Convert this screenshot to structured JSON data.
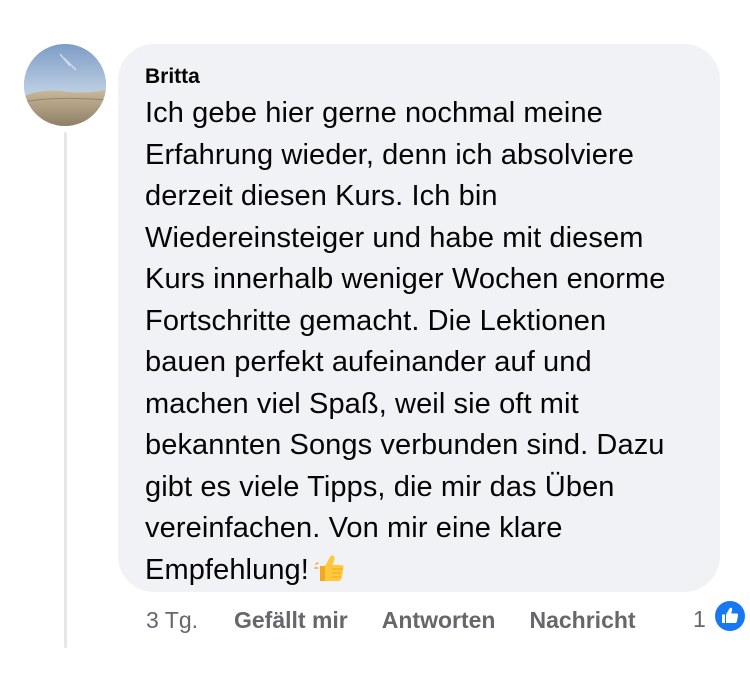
{
  "comment": {
    "author": "Britta",
    "text": "Ich gebe hier gerne nochmal meine\nErfahrung wieder, denn ich absolviere\nderzeit diesen Kurs. Ich bin\nWiedereinsteiger und habe mit diesem\nKurs innerhalb weniger Wochen enorme\nFortschritte gemacht. Die Lektionen\nbauen perfekt aufeinander auf und\nmachen viel Spaß, weil sie oft mit\nbekannten Songs verbunden sind. Dazu\ngibt es viele Tipps, die mir das Üben\nvereinfachen. Von mir eine klare\nEmpfehlung!",
    "emoji": "thumbs-up-emoji"
  },
  "actions": {
    "time": "3 Tg.",
    "like_label": "Gefällt mir",
    "reply_label": "Antworten",
    "message_label": "Nachricht"
  },
  "reactions": {
    "count": "1",
    "icon": "like-reaction-icon",
    "color": "#1877f2"
  },
  "colors": {
    "bubble": "#f0f2f5",
    "text": "#050505",
    "secondary": "#65676b",
    "thread_line": "#e4e6ea"
  }
}
